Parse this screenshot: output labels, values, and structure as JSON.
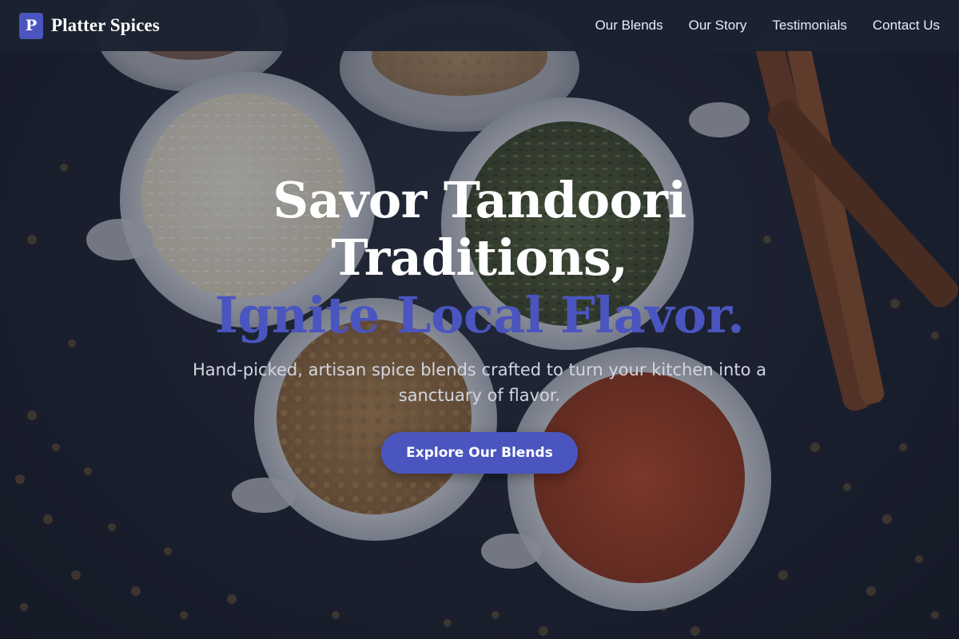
{
  "brand": {
    "logo_letter": "P",
    "name": "Platter Spices"
  },
  "nav": {
    "links": [
      "Our Blends",
      "Our Story",
      "Testimonials",
      "Contact Us"
    ]
  },
  "hero": {
    "title_line1": "Savor Tandoori",
    "title_line2": "Traditions,",
    "title_accent": "Ignite Local Flavor.",
    "subtitle": "Hand-picked, artisan spice blends crafted to turn your kitchen into a sanctuary of flavor.",
    "cta_label": "Explore Our Blends",
    "background_image": "spice-bowls-photo"
  },
  "colors": {
    "accent": "#4a55bf",
    "navbar": "#1b2131",
    "text": "#ffffff"
  }
}
